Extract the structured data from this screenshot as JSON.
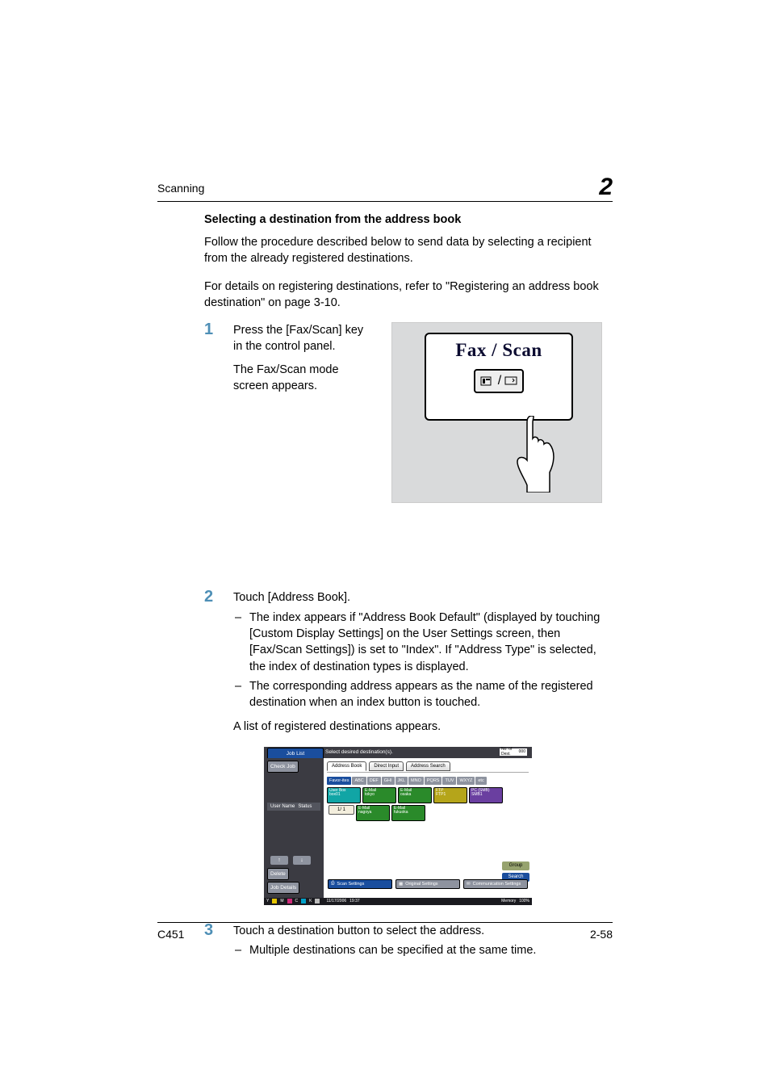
{
  "header": {
    "section": "Scanning",
    "chapter_number": "2"
  },
  "section_title": "Selecting a destination from the address book",
  "paragraphs": {
    "intro1": "Follow the procedure described below to send data by selecting a recipient from the already registered destinations.",
    "intro2": "For details on registering destinations, refer to \"Registering an address book destination\" on page 3-10."
  },
  "steps": {
    "s1": {
      "num": "1",
      "a": "Press the [Fax/Scan] key in the control panel.",
      "b": "The Fax/Scan mode screen appears."
    },
    "s2": {
      "num": "2",
      "a": "Touch [Address Book].",
      "sub1": "The index appears if \"Address Book Default\" (displayed by touching [Custom Display Settings] on the User Settings screen, then [Fax/Scan Settings]) is set to \"Index\". If \"Address Type\" is selected, the index of destination types is displayed.",
      "sub2": "The corresponding address appears as the name of the registered destination when an index button is touched.",
      "after": "A list of registered destinations appears."
    },
    "s3": {
      "num": "3",
      "a": "Touch a destination button to select the address.",
      "sub1": "Multiple destinations can be specified at the same time."
    }
  },
  "fig1": {
    "title": "Fax / Scan"
  },
  "screen": {
    "job_list": "Job List",
    "message": "Select desired destination(s).",
    "dest_label": "No. of Dest.",
    "dest_count": "000",
    "check_job": "Check Job",
    "user_status": {
      "left": "User Name",
      "right": "Status"
    },
    "up": "↑",
    "down": "↓",
    "delete": "Delete",
    "job_details": "Job Details",
    "tabs": {
      "address_book": "Address Book",
      "direct_input": "Direct Input",
      "address_search": "Address Search"
    },
    "index": {
      "favor": "Favor-ites",
      "abc": "ABC",
      "def": "DEF",
      "ghi": "GHI",
      "jkl": "JKL",
      "mno": "MNO",
      "pqrs": "PQRS",
      "tuv": "TUV",
      "wxyz": "WXYZ",
      "etc": "etc"
    },
    "dest_buttons": {
      "d1": {
        "type": "User Box",
        "name": "box01"
      },
      "d2": {
        "type": "E-Mail",
        "name": "tokyo"
      },
      "d3": {
        "type": "E-Mail",
        "name": "osaka"
      },
      "d4": {
        "type": "FTP",
        "name": "FTP1"
      },
      "d5": {
        "type": "PC (SMB)",
        "name": "SMB1"
      },
      "d6": {
        "type": "E-Mail",
        "name": "nagoya"
      },
      "d7": {
        "type": "E-Mail",
        "name": "fukuoka"
      }
    },
    "pager": "1/  1",
    "group": "Group",
    "search": "Search",
    "bottom": {
      "scan": "Scan Settings",
      "original": "Original Settings",
      "comm": "Communication Settings"
    },
    "status_bar": {
      "y": "Y",
      "m": "M",
      "c": "C",
      "k": "K",
      "date": "11/17/2006",
      "time": "19:37",
      "mem_label": "Memory",
      "mem_value": "100%"
    }
  },
  "footer": {
    "model": "C451",
    "page": "2-58"
  }
}
